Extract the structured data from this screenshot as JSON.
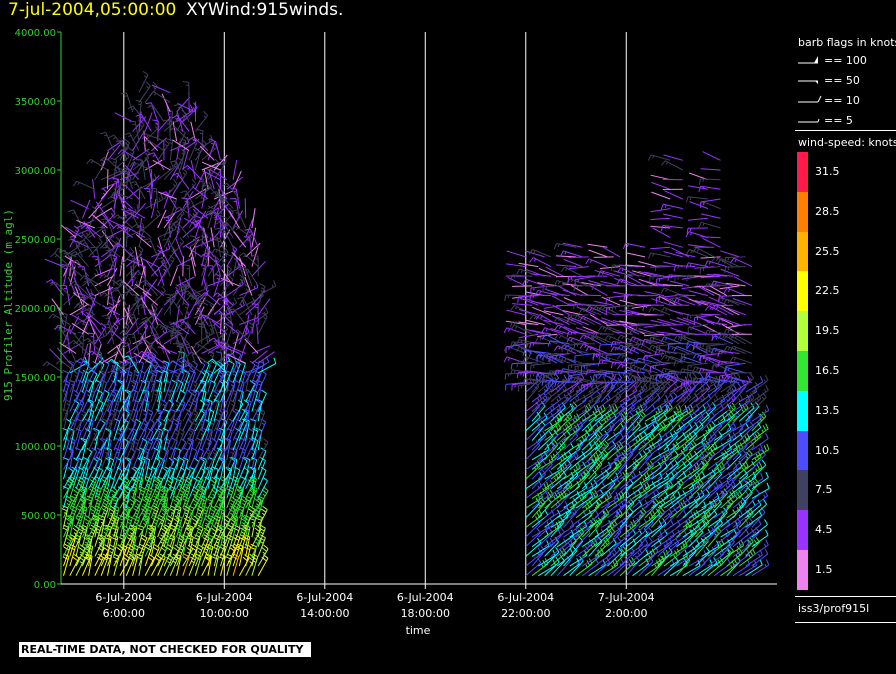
{
  "header": {
    "time_label": "7-jul-2004,05:00:00",
    "product_label": "XYWind:915winds."
  },
  "disclaimer": "REAL-TIME DATA, NOT CHECKED FOR QUALITY",
  "side_panel": {
    "barb_flags_title": "barb flags in knots",
    "barb_flags": [
      "== 100",
      "== 50",
      "== 10",
      "== 5"
    ],
    "wind_speed_title": "wind-speed: knots",
    "colorbar": [
      {
        "label": "31.5",
        "color": "#ff1a4a"
      },
      {
        "label": "28.5",
        "color": "#ff7f00"
      },
      {
        "label": "25.5",
        "color": "#ffb300"
      },
      {
        "label": "22.5",
        "color": "#ffff00"
      },
      {
        "label": "19.5",
        "color": "#b4ff3c"
      },
      {
        "label": "16.5",
        "color": "#33e633"
      },
      {
        "label": "13.5",
        "color": "#00ffff"
      },
      {
        "label": "10.5",
        "color": "#4d4dff"
      },
      {
        "label": "7.5",
        "color": "#404060"
      },
      {
        "label": "4.5",
        "color": "#9933ff"
      },
      {
        "label": "1.5",
        "color": "#ee82ee"
      }
    ],
    "source_label": "iss3/prof915l"
  },
  "chart_data": {
    "type": "scatter",
    "title": "XYWind:915winds.",
    "xlabel": "time",
    "ylabel": "915 Profiler Altitude (m agl)",
    "ylim": [
      0,
      4000
    ],
    "xlim_hours": [
      3.5,
      32.0
    ],
    "y_ticks": [
      "0.00",
      "500.00",
      "1000.00",
      "1500.00",
      "2000.00",
      "2500.00",
      "3000.00",
      "3500.00",
      "4000.00"
    ],
    "x_ticks": [
      {
        "date": "6-Jul-2004",
        "time": "6:00:00"
      },
      {
        "date": "6-Jul-2004",
        "time": "10:00:00"
      },
      {
        "date": "6-Jul-2004",
        "time": "14:00:00"
      },
      {
        "date": "6-Jul-2004",
        "time": "18:00:00"
      },
      {
        "date": "6-Jul-2004",
        "time": "22:00:00"
      },
      {
        "date": "7-Jul-2004",
        "time": "2:00:00"
      }
    ],
    "grid_x": true,
    "series": [
      {
        "segment": "6-Jul-2004 04:00 to 11:30",
        "max_altitude_m": 3800,
        "wind_speed_knots_low_levels": [
          13.5,
          25.5
        ],
        "wind_speed_knots_upper_levels": [
          1.5,
          7.5
        ]
      },
      {
        "segment": "6-Jul-2004 22:00 to 7-Jul-2004 05:00",
        "max_altitude_m": 3100,
        "wind_speed_knots_low_levels": [
          10.5,
          16.5
        ],
        "wind_speed_knots_upper_levels": [
          1.5,
          7.5
        ]
      }
    ]
  }
}
